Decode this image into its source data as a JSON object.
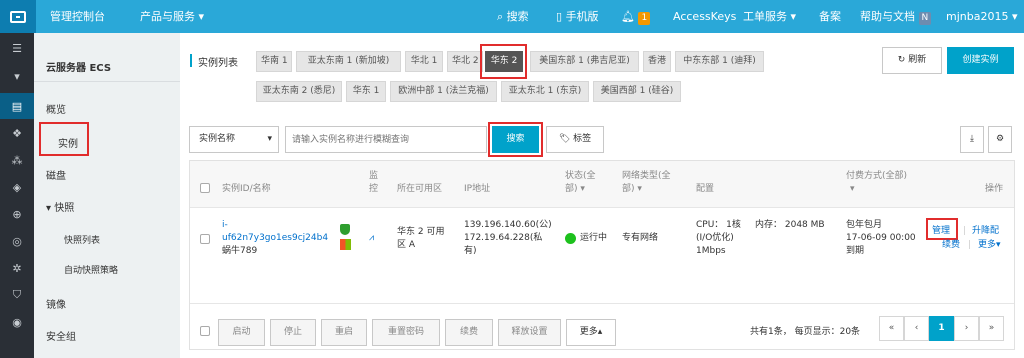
{
  "topbar": {
    "console": "管理控制台",
    "products": "产品与服务 ▾",
    "search": "搜索",
    "mobile": "手机版",
    "notif_count": "1",
    "accesskeys": "AccessKeys",
    "tickets": "工单服务 ▾",
    "beian": "备案",
    "help": "帮助与文档",
    "user": "mjnba2015 ▾"
  },
  "sidebar": {
    "title": "云服务器 ECS",
    "items": [
      {
        "label": "概览"
      },
      {
        "label": "实例"
      },
      {
        "label": "磁盘"
      },
      {
        "label": "▾ 快照"
      },
      {
        "label": "快照列表"
      },
      {
        "label": "自动快照策略"
      },
      {
        "label": "镜像"
      },
      {
        "label": "安全组"
      }
    ]
  },
  "regions": {
    "title": "实例列表",
    "row1": [
      "华南 1",
      "亚太东南 1 (新加坡)",
      "华北 1",
      "华北 2",
      "华东 2",
      "美国东部 1 (弗吉尼亚)",
      "香港",
      "中东东部 1 (迪拜)"
    ],
    "row2": [
      "亚太东南 2 (悉尼)",
      "华东 1",
      "欧洲中部 1 (法兰克福)",
      "亚太东北 1 (东京)",
      "美国西部 1 (硅谷)"
    ],
    "refresh": "刷新",
    "create": "创建实例"
  },
  "search": {
    "select": "实例名称",
    "placeholder": "请输入实例名称进行模糊查询",
    "button": "搜索",
    "tag": "标签"
  },
  "table": {
    "headers": {
      "id": "实例ID/名称",
      "monitor1": "监",
      "monitor2": "控",
      "zone": "所在可用区",
      "ip": "IP地址",
      "status1": "状态(全",
      "status2": "部) ▾",
      "net1": "网络类型(全",
      "net2": "部) ▾",
      "config": "配置",
      "pay1": "付费方式(全部)",
      "pay2": "▾",
      "ops": "操作"
    },
    "row": {
      "id1": "i-",
      "id2": "uf62n7y3go1es9cj24b4",
      "name": "蜗牛789",
      "zone1": "华东 2 可用",
      "zone2": "区 A",
      "ip1": "139.196.140.60(公)",
      "ip2": "172.19.64.228(私",
      "ip3": "有)",
      "status": "运行中",
      "net": "专有网络",
      "cpu": "CPU： 1核",
      "mem": "内存： 2048 MB",
      "io": "(I/O优化)",
      "bw": "1Mbps",
      "pay1": "包年包月",
      "pay2": "17-06-09 00:00",
      "pay3": "到期",
      "manage": "管理",
      "upgrade": "升降配",
      "renew": "续费",
      "more": "更多▾"
    }
  },
  "footer": {
    "buttons": [
      "启动",
      "停止",
      "重启",
      "重置密码",
      "续费",
      "释放设置"
    ],
    "more": "更多▴",
    "summary": "共有1条， 每页显示：20条",
    "pages": [
      "«",
      "‹",
      "1",
      "›",
      "»"
    ]
  },
  "colors": {
    "accent": "#00a2ca",
    "topbar": "#2aa8d8",
    "highlight": "#e12c2c",
    "running": "#1dc11d"
  }
}
